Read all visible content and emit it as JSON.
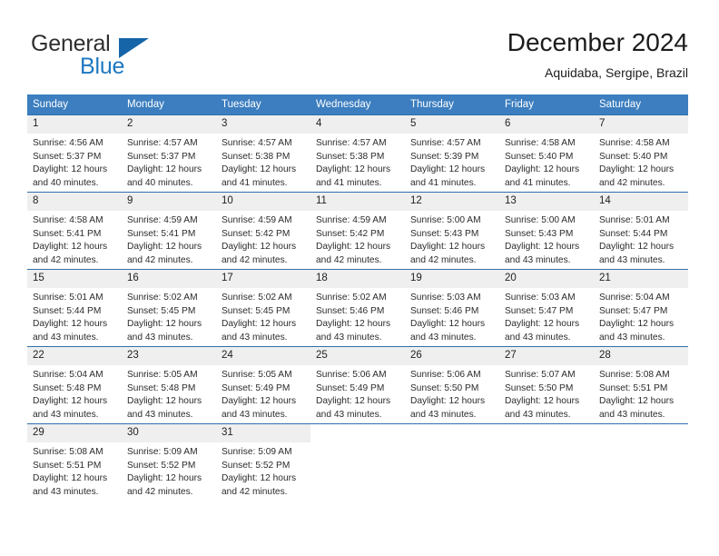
{
  "brand": {
    "name_part1": "General",
    "name_part2": "Blue",
    "triangle_icon": "triangle-icon",
    "accent_color": "#1d78c1",
    "triangle_color": "#1565a8"
  },
  "header": {
    "title": "December 2024",
    "subtitle": "Aquidaba, Sergipe, Brazil"
  },
  "calendar": {
    "header_bg": "#3c7ebf",
    "header_text_color": "#ffffff",
    "daynum_band_bg": "#efefef",
    "row_separator_color": "#2f6fae",
    "weekday_headers": [
      "Sunday",
      "Monday",
      "Tuesday",
      "Wednesday",
      "Thursday",
      "Friday",
      "Saturday"
    ],
    "weeks": [
      [
        {
          "day": "1",
          "sunrise": "Sunrise: 4:56 AM",
          "sunset": "Sunset: 5:37 PM",
          "daylight": "Daylight: 12 hours and 40 minutes."
        },
        {
          "day": "2",
          "sunrise": "Sunrise: 4:57 AM",
          "sunset": "Sunset: 5:37 PM",
          "daylight": "Daylight: 12 hours and 40 minutes."
        },
        {
          "day": "3",
          "sunrise": "Sunrise: 4:57 AM",
          "sunset": "Sunset: 5:38 PM",
          "daylight": "Daylight: 12 hours and 41 minutes."
        },
        {
          "day": "4",
          "sunrise": "Sunrise: 4:57 AM",
          "sunset": "Sunset: 5:38 PM",
          "daylight": "Daylight: 12 hours and 41 minutes."
        },
        {
          "day": "5",
          "sunrise": "Sunrise: 4:57 AM",
          "sunset": "Sunset: 5:39 PM",
          "daylight": "Daylight: 12 hours and 41 minutes."
        },
        {
          "day": "6",
          "sunrise": "Sunrise: 4:58 AM",
          "sunset": "Sunset: 5:40 PM",
          "daylight": "Daylight: 12 hours and 41 minutes."
        },
        {
          "day": "7",
          "sunrise": "Sunrise: 4:58 AM",
          "sunset": "Sunset: 5:40 PM",
          "daylight": "Daylight: 12 hours and 42 minutes."
        }
      ],
      [
        {
          "day": "8",
          "sunrise": "Sunrise: 4:58 AM",
          "sunset": "Sunset: 5:41 PM",
          "daylight": "Daylight: 12 hours and 42 minutes."
        },
        {
          "day": "9",
          "sunrise": "Sunrise: 4:59 AM",
          "sunset": "Sunset: 5:41 PM",
          "daylight": "Daylight: 12 hours and 42 minutes."
        },
        {
          "day": "10",
          "sunrise": "Sunrise: 4:59 AM",
          "sunset": "Sunset: 5:42 PM",
          "daylight": "Daylight: 12 hours and 42 minutes."
        },
        {
          "day": "11",
          "sunrise": "Sunrise: 4:59 AM",
          "sunset": "Sunset: 5:42 PM",
          "daylight": "Daylight: 12 hours and 42 minutes."
        },
        {
          "day": "12",
          "sunrise": "Sunrise: 5:00 AM",
          "sunset": "Sunset: 5:43 PM",
          "daylight": "Daylight: 12 hours and 42 minutes."
        },
        {
          "day": "13",
          "sunrise": "Sunrise: 5:00 AM",
          "sunset": "Sunset: 5:43 PM",
          "daylight": "Daylight: 12 hours and 43 minutes."
        },
        {
          "day": "14",
          "sunrise": "Sunrise: 5:01 AM",
          "sunset": "Sunset: 5:44 PM",
          "daylight": "Daylight: 12 hours and 43 minutes."
        }
      ],
      [
        {
          "day": "15",
          "sunrise": "Sunrise: 5:01 AM",
          "sunset": "Sunset: 5:44 PM",
          "daylight": "Daylight: 12 hours and 43 minutes."
        },
        {
          "day": "16",
          "sunrise": "Sunrise: 5:02 AM",
          "sunset": "Sunset: 5:45 PM",
          "daylight": "Daylight: 12 hours and 43 minutes."
        },
        {
          "day": "17",
          "sunrise": "Sunrise: 5:02 AM",
          "sunset": "Sunset: 5:45 PM",
          "daylight": "Daylight: 12 hours and 43 minutes."
        },
        {
          "day": "18",
          "sunrise": "Sunrise: 5:02 AM",
          "sunset": "Sunset: 5:46 PM",
          "daylight": "Daylight: 12 hours and 43 minutes."
        },
        {
          "day": "19",
          "sunrise": "Sunrise: 5:03 AM",
          "sunset": "Sunset: 5:46 PM",
          "daylight": "Daylight: 12 hours and 43 minutes."
        },
        {
          "day": "20",
          "sunrise": "Sunrise: 5:03 AM",
          "sunset": "Sunset: 5:47 PM",
          "daylight": "Daylight: 12 hours and 43 minutes."
        },
        {
          "day": "21",
          "sunrise": "Sunrise: 5:04 AM",
          "sunset": "Sunset: 5:47 PM",
          "daylight": "Daylight: 12 hours and 43 minutes."
        }
      ],
      [
        {
          "day": "22",
          "sunrise": "Sunrise: 5:04 AM",
          "sunset": "Sunset: 5:48 PM",
          "daylight": "Daylight: 12 hours and 43 minutes."
        },
        {
          "day": "23",
          "sunrise": "Sunrise: 5:05 AM",
          "sunset": "Sunset: 5:48 PM",
          "daylight": "Daylight: 12 hours and 43 minutes."
        },
        {
          "day": "24",
          "sunrise": "Sunrise: 5:05 AM",
          "sunset": "Sunset: 5:49 PM",
          "daylight": "Daylight: 12 hours and 43 minutes."
        },
        {
          "day": "25",
          "sunrise": "Sunrise: 5:06 AM",
          "sunset": "Sunset: 5:49 PM",
          "daylight": "Daylight: 12 hours and 43 minutes."
        },
        {
          "day": "26",
          "sunrise": "Sunrise: 5:06 AM",
          "sunset": "Sunset: 5:50 PM",
          "daylight": "Daylight: 12 hours and 43 minutes."
        },
        {
          "day": "27",
          "sunrise": "Sunrise: 5:07 AM",
          "sunset": "Sunset: 5:50 PM",
          "daylight": "Daylight: 12 hours and 43 minutes."
        },
        {
          "day": "28",
          "sunrise": "Sunrise: 5:08 AM",
          "sunset": "Sunset: 5:51 PM",
          "daylight": "Daylight: 12 hours and 43 minutes."
        }
      ],
      [
        {
          "day": "29",
          "sunrise": "Sunrise: 5:08 AM",
          "sunset": "Sunset: 5:51 PM",
          "daylight": "Daylight: 12 hours and 43 minutes."
        },
        {
          "day": "30",
          "sunrise": "Sunrise: 5:09 AM",
          "sunset": "Sunset: 5:52 PM",
          "daylight": "Daylight: 12 hours and 42 minutes."
        },
        {
          "day": "31",
          "sunrise": "Sunrise: 5:09 AM",
          "sunset": "Sunset: 5:52 PM",
          "daylight": "Daylight: 12 hours and 42 minutes."
        },
        {
          "day": "",
          "sunrise": "",
          "sunset": "",
          "daylight": ""
        },
        {
          "day": "",
          "sunrise": "",
          "sunset": "",
          "daylight": ""
        },
        {
          "day": "",
          "sunrise": "",
          "sunset": "",
          "daylight": ""
        },
        {
          "day": "",
          "sunrise": "",
          "sunset": "",
          "daylight": ""
        }
      ]
    ]
  }
}
